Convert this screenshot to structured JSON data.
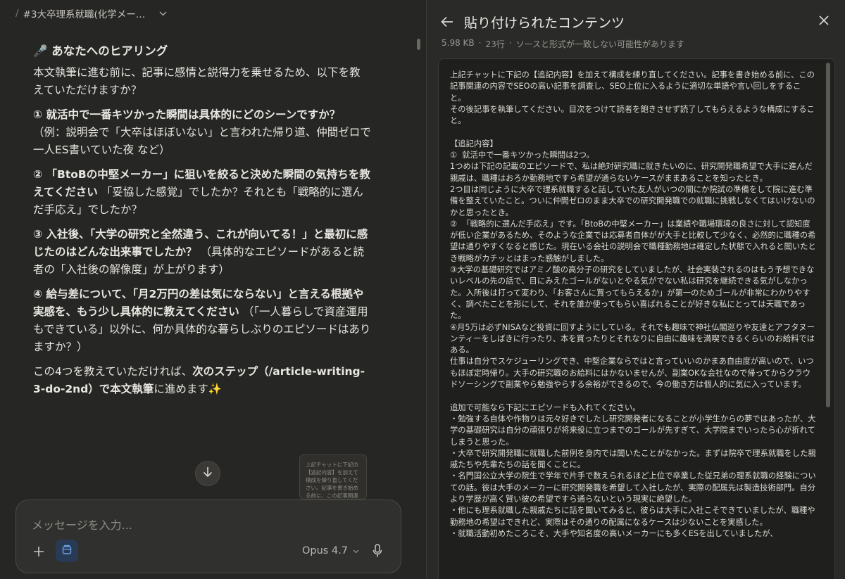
{
  "left": {
    "header": {
      "slash": "/",
      "title": "#3大卒理系就職(化学メー…"
    },
    "heading": "🎤 あなたへのヒアリング",
    "intro": "本文執筆に進む前に、記事に感情と説得力を乗せるため、以下を教えていただけますか？",
    "q1_bold": "① 就活中で一番キツかった瞬間は具体的にどのシーンですか？",
    "q1_rest": "（例：説明会で「大卒はほぼいない」と言われた帰り道、仲間ゼロで一人ES書いていた夜 など）",
    "q2_bold": "② 「BtoBの中堅メーカー」に狙いを絞ると決めた瞬間の気持ちを教えてください",
    "q2_rest": " 「妥協した感覚」でしたか？それとも「戦略的に選んだ手応え」でしたか？",
    "q3_bold": "③ 入社後、「大学の研究と全然違う、これが向いてる！」と最初に感じたのはどんな出来事でしたか？",
    "q3_rest": " （具体的なエピソードがあると読者の「入社後の解像度」が上がります）",
    "q4_bold": "④ 給与差について、「月2万円の差は気にならない」と言える根拠や実感を、もう少し具体的に教えてください",
    "q4_rest": " （「一人暮らしで資産運用もできている」以外に、何か具体的な暮らしぶりのエピソードはありますか？）",
    "outro_pre": "この4つを教えていただければ、",
    "outro_bold": "次のステップ（/article-writing-3-do-2nd）で本文執筆",
    "outro_post": "に進めます✨",
    "paste_thumb_text": "上記チャットに下記の【追記内容】を加えて構成を練り直してください。記事を書き始める前に、この記事関連の内容でSEOの高い記",
    "composer": {
      "placeholder": "メッセージを入力...",
      "model": "Opus 4.7"
    }
  },
  "right": {
    "title": "貼り付けられたコンテンツ",
    "meta_size": "5.98 KB",
    "meta_lines": "23行",
    "meta_note": "ソースと形式が一致しない可能性があります",
    "doc": "上記チャットに下記の【追記内容】を加えて構成を練り直してください。記事を書き始める前に、この記事関連の内容でSEOの高い記事を調査し、SEO上位に入るように適切な単語や言い回しをすること。\nその後記事を執筆してください。目次をつけて読者を飽きさせず読了してもらえるような構成にすること。\n\n【追記内容】\n①  就活中で一番キツかった瞬間は2つ。\n1つめは下記の記載のエピソードで、私は絶対研究職に就きたいのに、研究開発職希望で大手に進んだ親戚は、職種はおろか勤務地ですら希望が通らないケースがままあることを知ったとき。\n2つ目は同じように大卒で理系就職すると話していた友人がいつの間にか院試の準備をして院に進む準備を整えていたこと。ついに仲間ゼロのまま大卒での研究開発職での就職に挑戦しなくてはいけないのかと思ったとき。\n②  「戦略的に選んだ手応え」です。「BtoBの中堅メーカー」は業績や職場環境の良さに対して認知度が低い企業があるため、そのような企業では応募者自体がが大手と比較して少なく、必然的に職種の希望は通りやすくなると感じた。現在いる会社の説明会で職種勤務地は確定した状態で入れると聞いたとき戦略がカチッとはまった感触がしました。\n③大学の基礎研究ではアミノ酸の高分子の研究をしていましたが、社会実装されるのはもう予想できないレベルの先の話で、目にみえたゴールがないとやる気がでない私は研究を継続できる気がしなかった。入所後は打って変わり、「お客さんに買ってもらえるか」が第一のためゴールが非常にわかりやすく、調べたことを形にして、それを誰か使ってもらい喜ばれることが好きな私にとっては天職であった。\n④月5万は必ずNISAなど投資に回すようにしている。それでも趣味で神社仏閣巡りや友達とアフタヌーンティーをしばきに行ったり、本を買ったりとそれなりに自由に趣味を満喫できるくらいのお給料ではある。\n仕事は自分でスケジューリングでき、中堅企業ならではと言っていいのかまあ自由度が高いので、いつもほぼ定時帰り。大手の研究職のお給料にはかないませんが、副業OKな会社なので帰ってからクラウドソーシングで副業やら勉強やらする余裕ができるので、今の働き方は個人的に気に入っています。\n\n追加で可能なら下記にエピソードも入れてください。\n・勉強する自体や作物りは元々好きでしたし研究開発者になることが小学生からの夢ではあったが、大学の基礎研究は自分の頑張りが将来役に立つまでのゴールが先すぎて、大学院までいったら心が折れてしまうと思った。\n・大卒で研究開発職に就職した前例を身内では聞いたことがなかった。まずは院卒で理系就職をした親戚たちや先輩たちの話を聞くことに。\n・名門国公立大学の院生で学年で片手で数えられるほど上位で卒業した従兄弟の理系就職の経験についての話。彼は大手のメーカーに研究開発職を希望して入社したが、実際の配属先は製造技術部門。自分より学歴が高く賢い彼の希望ですら通らないという現実に絶望した。\n・他にも理系就職した親戚たちに話を聞いてみると、彼らは大手に入社こそできていましたが、職種や勤務地の希望はできれど、実際はその通りの配属になるケースは少ないことを実感した。\n・就職活動初めたころこそ、大手や知名度の高いメーカーにも多くESを出していましたが、"
  }
}
